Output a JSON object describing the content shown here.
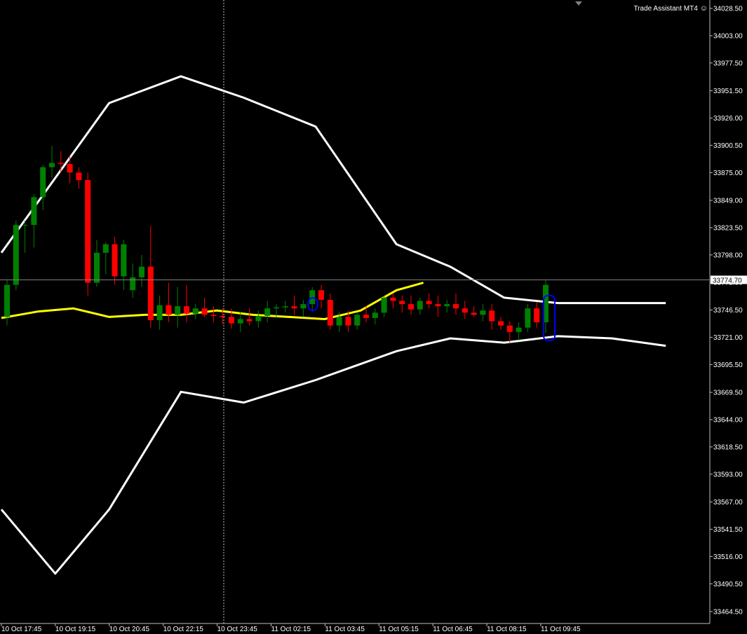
{
  "expert": {
    "name": "Trade Assistant MT4",
    "icon": "smiley-icon"
  },
  "colors": {
    "background": "#000000",
    "bull": "#008000",
    "bear": "#ff0000",
    "band": "#ffffff",
    "ma": "#ffff00",
    "drawing": "#0000ff",
    "axis": "#c0c0c0",
    "grid": "#808080"
  },
  "chart_data": {
    "type": "candlestick",
    "symbol_price_axis": {
      "ticks": [
        "34028.50",
        "34003.00",
        "33977.50",
        "33951.50",
        "33926.00",
        "33900.50",
        "33875.00",
        "33849.00",
        "33823.50",
        "33798.00",
        "33772.50",
        "33746.50",
        "33721.00",
        "33695.50",
        "33669.50",
        "33644.00",
        "33618.50",
        "33593.00",
        "33567.00",
        "33541.50",
        "33516.00",
        "33490.50",
        "33464.50"
      ],
      "ylim": [
        33458,
        34032
      ]
    },
    "time_axis": {
      "ticks": [
        "10 Oct 17:45",
        "10 Oct 19:15",
        "10 Oct 20:45",
        "10 Oct 22:15",
        "10 Oct 23:45",
        "11 Oct 02:15",
        "11 Oct 03:45",
        "11 Oct 05:15",
        "11 Oct 06:45",
        "11 Oct 08:15",
        "11 Oct 09:45"
      ]
    },
    "current_price": "33774.70",
    "candles": [
      [
        33740,
        33775,
        33732,
        33770
      ],
      [
        33770,
        33830,
        33765,
        33826
      ],
      [
        33826,
        33830,
        33800,
        33826
      ],
      [
        33826,
        33855,
        33805,
        33852
      ],
      [
        33852,
        33882,
        33840,
        33880
      ],
      [
        33880,
        33900,
        33870,
        33884
      ],
      [
        33884,
        33895,
        33875,
        33883
      ],
      [
        33883,
        33890,
        33865,
        33875
      ],
      [
        33875,
        33880,
        33860,
        33868
      ],
      [
        33868,
        33875,
        33760,
        33772
      ],
      [
        33772,
        33812,
        33768,
        33800
      ],
      [
        33800,
        33810,
        33780,
        33808
      ],
      [
        33808,
        33815,
        33770,
        33778
      ],
      [
        33778,
        33812,
        33765,
        33808
      ],
      [
        33765,
        33790,
        33758,
        33777
      ],
      [
        33777,
        33798,
        33768,
        33787
      ],
      [
        33787,
        33825,
        33730,
        33737
      ],
      [
        33737,
        33760,
        33728,
        33751
      ],
      [
        33751,
        33772,
        33735,
        33742
      ],
      [
        33742,
        33768,
        33730,
        33750
      ],
      [
        33750,
        33770,
        33735,
        33743
      ],
      [
        33743,
        33752,
        33738,
        33748
      ],
      [
        33748,
        33758,
        33740,
        33742
      ],
      [
        33742,
        33750,
        33735,
        33741
      ],
      [
        33741,
        33748,
        33733,
        33740
      ],
      [
        33740,
        33748,
        33729,
        33734
      ],
      [
        33734,
        33745,
        33726,
        33738
      ],
      [
        33738,
        33748,
        33732,
        33736
      ],
      [
        33736,
        33746,
        33730,
        33741
      ],
      [
        33741,
        33755,
        33735,
        33748
      ],
      [
        33748,
        33752,
        33740,
        33749
      ],
      [
        33749,
        33755,
        33744,
        33750
      ],
      [
        33750,
        33760,
        33742,
        33748
      ],
      [
        33748,
        33756,
        33740,
        33752
      ],
      [
        33752,
        33768,
        33745,
        33765
      ],
      [
        33765,
        33770,
        33748,
        33756
      ],
      [
        33756,
        33762,
        33728,
        33732
      ],
      [
        33732,
        33745,
        33726,
        33740
      ],
      [
        33740,
        33746,
        33726,
        33732
      ],
      [
        33732,
        33744,
        33728,
        33742
      ],
      [
        33742,
        33750,
        33735,
        33739
      ],
      [
        33739,
        33748,
        33733,
        33744
      ],
      [
        33744,
        33760,
        33740,
        33758
      ],
      [
        33758,
        33762,
        33748,
        33755
      ],
      [
        33755,
        33760,
        33744,
        33752
      ],
      [
        33752,
        33760,
        33742,
        33747
      ],
      [
        33747,
        33758,
        33742,
        33755
      ],
      [
        33755,
        33762,
        33748,
        33752
      ],
      [
        33752,
        33760,
        33740,
        33750
      ],
      [
        33750,
        33756,
        33744,
        33752
      ],
      [
        33752,
        33762,
        33742,
        33748
      ],
      [
        33748,
        33755,
        33738,
        33744
      ],
      [
        33744,
        33750,
        33740,
        33742
      ],
      [
        33742,
        33752,
        33736,
        33746
      ],
      [
        33746,
        33752,
        33728,
        33736
      ],
      [
        33736,
        33740,
        33728,
        33732
      ],
      [
        33732,
        33736,
        33716,
        33726
      ],
      [
        33726,
        33735,
        33718,
        33730
      ],
      [
        33730,
        33752,
        33726,
        33748
      ],
      [
        33748,
        33754,
        33730,
        33735
      ],
      [
        33735,
        33775,
        33725,
        33770
      ]
    ],
    "upper_band": [
      [
        0,
        33800
      ],
      [
        6,
        33870
      ],
      [
        12,
        33940
      ],
      [
        20,
        33965
      ],
      [
        27,
        33945
      ],
      [
        35,
        33918
      ],
      [
        44,
        33808
      ],
      [
        50,
        33787
      ],
      [
        56,
        33758
      ],
      [
        62,
        33753
      ],
      [
        68,
        33753
      ],
      [
        74,
        33753
      ]
    ],
    "lower_band": [
      [
        0,
        33560
      ],
      [
        6,
        33500
      ],
      [
        12,
        33560
      ],
      [
        20,
        33670
      ],
      [
        27,
        33660
      ],
      [
        35,
        33681
      ],
      [
        44,
        33708
      ],
      [
        50,
        33720
      ],
      [
        56,
        33716
      ],
      [
        62,
        33722
      ],
      [
        68,
        33720
      ],
      [
        74,
        33713
      ]
    ],
    "ma_line": [
      [
        0,
        33739
      ],
      [
        4,
        33745
      ],
      [
        8,
        33748
      ],
      [
        12,
        33740
      ],
      [
        16,
        33742
      ],
      [
        20,
        33742
      ],
      [
        24,
        33746
      ],
      [
        28,
        33742
      ],
      [
        32,
        33740
      ],
      [
        36,
        33738
      ],
      [
        40,
        33746
      ],
      [
        44,
        33765
      ],
      [
        47,
        33772
      ]
    ]
  }
}
